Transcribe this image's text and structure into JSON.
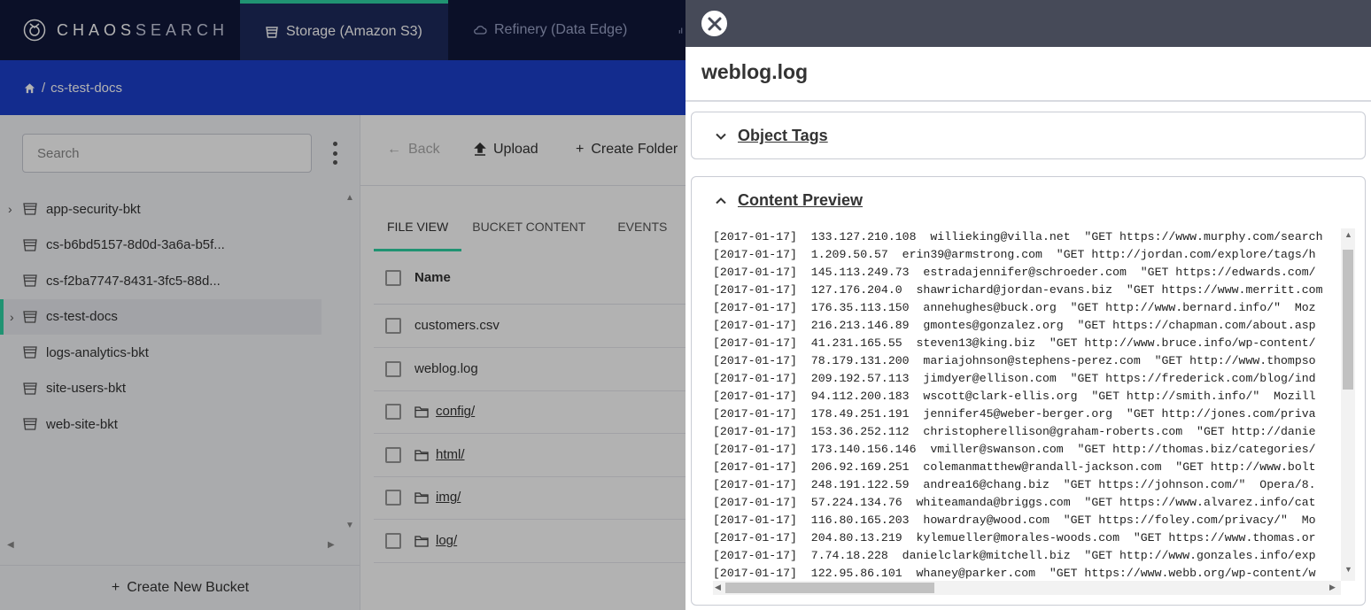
{
  "topbar": {
    "logo_text_a": "CHAOS",
    "logo_text_b": "SEARCH",
    "tabs": [
      {
        "label": "Storage (Amazon S3)",
        "icon": "bucket-icon",
        "active": true
      },
      {
        "label": "Refinery (Data Edge)",
        "icon": "cloud-icon",
        "active": false
      }
    ]
  },
  "breadcrumb": {
    "separator": "/",
    "current": "cs-test-docs"
  },
  "sidebar": {
    "search_placeholder": "Search",
    "buckets": [
      {
        "label": "app-security-bkt",
        "expandable": true,
        "selected": false
      },
      {
        "label": "cs-b6bd5157-8d0d-3a6a-b5f...",
        "expandable": false,
        "selected": false
      },
      {
        "label": "cs-f2ba7747-8431-3fc5-88d...",
        "expandable": false,
        "selected": false
      },
      {
        "label": "cs-test-docs",
        "expandable": true,
        "selected": true
      },
      {
        "label": "logs-analytics-bkt",
        "expandable": false,
        "selected": false
      },
      {
        "label": "site-users-bkt",
        "expandable": false,
        "selected": false
      },
      {
        "label": "web-site-bkt",
        "expandable": false,
        "selected": false
      }
    ],
    "create_bucket": "Create New Bucket"
  },
  "toolbar": {
    "back": "Back",
    "upload": "Upload",
    "create_folder": "Create Folder"
  },
  "tabs": {
    "file_view": "FILE VIEW",
    "bucket_content": "BUCKET CONTENT",
    "events": "EVENTS"
  },
  "table": {
    "header_name": "Name",
    "rows": [
      {
        "name": "customers.csv",
        "folder": false
      },
      {
        "name": "weblog.log",
        "folder": false
      },
      {
        "name": "config/",
        "folder": true
      },
      {
        "name": "html/",
        "folder": true
      },
      {
        "name": "img/",
        "folder": true
      },
      {
        "name": "log/",
        "folder": true
      }
    ]
  },
  "drawer": {
    "title": "weblog.log",
    "object_tags": "Object Tags",
    "content_preview": "Content Preview",
    "lines": [
      "[2017-01-17]  133.127.210.108  willieking@villa.net  \"GET https://www.murphy.com/search",
      "[2017-01-17]  1.209.50.57  erin39@armstrong.com  \"GET http://jordan.com/explore/tags/h",
      "[2017-01-17]  145.113.249.73  estradajennifer@schroeder.com  \"GET https://edwards.com/",
      "[2017-01-17]  127.176.204.0  shawrichard@jordan-evans.biz  \"GET https://www.merritt.com",
      "[2017-01-17]  176.35.113.150  annehughes@buck.org  \"GET http://www.bernard.info/\"  Moz",
      "[2017-01-17]  216.213.146.89  gmontes@gonzalez.org  \"GET https://chapman.com/about.asp",
      "[2017-01-17]  41.231.165.55  steven13@king.biz  \"GET http://www.bruce.info/wp-content/",
      "[2017-01-17]  78.179.131.200  mariajohnson@stephens-perez.com  \"GET http://www.thompso",
      "[2017-01-17]  209.192.57.113  jimdyer@ellison.com  \"GET https://frederick.com/blog/ind",
      "[2017-01-17]  94.112.200.183  wscott@clark-ellis.org  \"GET http://smith.info/\"  Mozill",
      "[2017-01-17]  178.49.251.191  jennifer45@weber-berger.org  \"GET http://jones.com/priva",
      "[2017-01-17]  153.36.252.112  christopherellison@graham-roberts.com  \"GET http://danie",
      "[2017-01-17]  173.140.156.146  vmiller@swanson.com  \"GET http://thomas.biz/categories/",
      "[2017-01-17]  206.92.169.251  colemanmatthew@randall-jackson.com  \"GET http://www.bolt",
      "[2017-01-17]  248.191.122.59  andrea16@chang.biz  \"GET https://johnson.com/\"  Opera/8.",
      "[2017-01-17]  57.224.134.76  whiteamanda@briggs.com  \"GET https://www.alvarez.info/cat",
      "[2017-01-17]  116.80.165.203  howardray@wood.com  \"GET https://foley.com/privacy/\"  Mo",
      "[2017-01-17]  204.80.13.219  kylemueller@morales-woods.com  \"GET https://www.thomas.or",
      "[2017-01-17]  7.74.18.228  danielclark@mitchell.biz  \"GET http://www.gonzales.info/exp",
      "[2017-01-17]  122.95.86.101  whaney@parker.com  \"GET https://www.webb.org/wp-content/w"
    ]
  }
}
